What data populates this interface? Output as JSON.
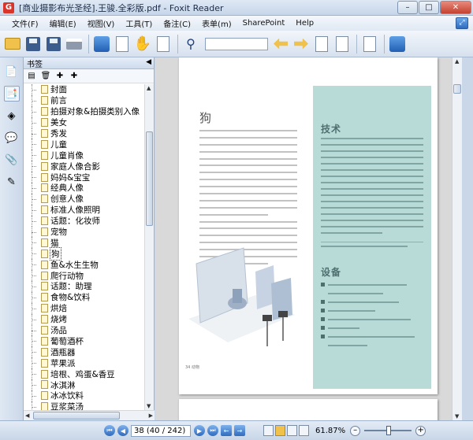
{
  "window": {
    "title": "[商业摄影布光圣经].王骏.全彩版.pdf - Foxit Reader",
    "buttons": {
      "minimize": "–",
      "maximize": "□",
      "close": "✕"
    }
  },
  "menu": {
    "items": [
      "文件(F)",
      "编辑(E)",
      "视图(V)",
      "工具(T)",
      "备注(C)",
      "表单(m)",
      "SharePoint",
      "Help"
    ]
  },
  "panel": {
    "title": "书签",
    "bookmarks": [
      "封面",
      "前言",
      "拍摄对象&拍摄类别入像",
      "美女",
      "秀发",
      "儿童",
      "儿童肖像",
      "家庭人像合影",
      "妈妈&宝宝",
      "经典人像",
      "创意人像",
      "标准人像照明",
      "话题：化妆师",
      "宠物",
      "猫",
      "狗",
      "鱼&水生生物",
      "爬行动物",
      "话题：助理",
      "食物&饮料",
      "烘焙",
      "烧烤",
      "汤品",
      "葡萄酒杯",
      "酒瓶器",
      "苹果派",
      "培根、鸡蛋&香豆",
      "冰淇淋",
      "冰冰饮料",
      "豆浆菜汤"
    ],
    "selected_index": 15
  },
  "document": {
    "page_heading": "狗",
    "right_heading_1": "技术",
    "right_heading_2": "设备",
    "footer_text": "34  动物"
  },
  "statusbar": {
    "page_value": "38 (40 / 242)",
    "zoom": "61.87%"
  },
  "colors": {
    "accent": "#2f6cbf",
    "page_panel": "#b9dbd8"
  }
}
